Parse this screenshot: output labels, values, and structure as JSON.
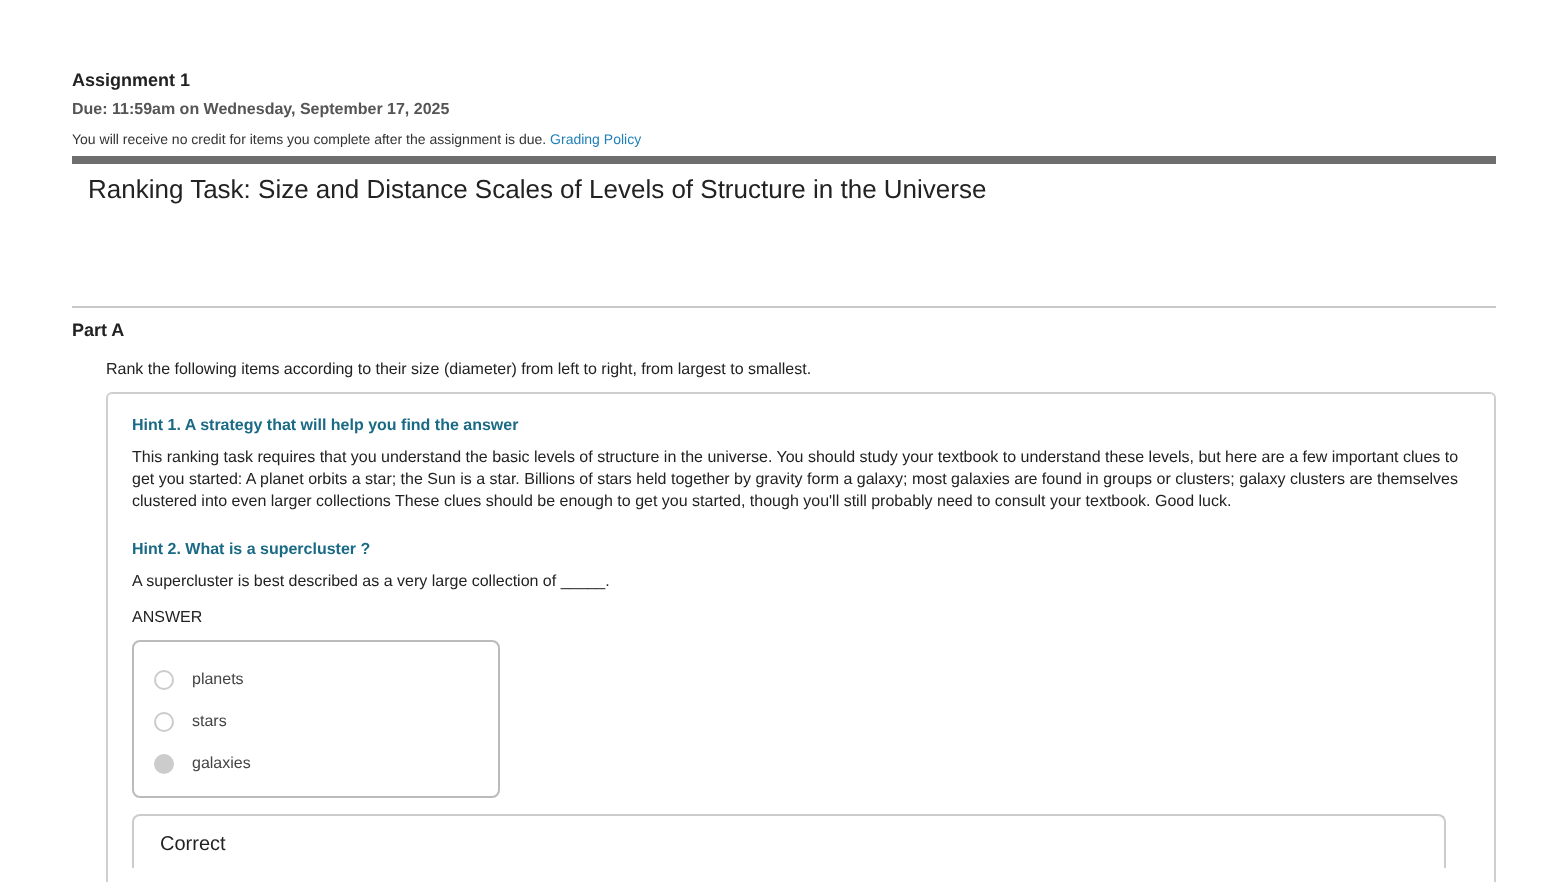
{
  "assignment": {
    "title": "Assignment 1",
    "due": "Due: 11:59am on Wednesday, September 17, 2025",
    "notice": "You will receive no credit for items you complete after the assignment is due.",
    "policy_link": "Grading Policy"
  },
  "task_title": "Ranking Task: Size and Distance Scales of Levels of Structure in the Universe",
  "part": {
    "label": "Part A",
    "instruction": "Rank the following items according to their size (diameter) from left to right, from largest to smallest.",
    "hints": [
      {
        "title": "Hint 1. A strategy that will help you find the answer",
        "text": "This ranking task requires that you understand the basic levels of structure in the universe. You should study your textbook to understand these levels, but here are a few important clues to get you started: A planet orbits a star; the Sun is a star. Billions of stars held together by gravity form a galaxy; most galaxies are found in groups or clusters; galaxy clusters are themselves clustered into even larger collections These clues should be enough to get you started, though you'll still probably need to consult your textbook. Good luck."
      },
      {
        "title": "Hint 2. What is a supercluster ?",
        "text": "A supercluster is best described as a very large collection of _____.",
        "answer_label": "ANSWER",
        "options": [
          {
            "label": "planets",
            "selected": false
          },
          {
            "label": "stars",
            "selected": false
          },
          {
            "label": "galaxies",
            "selected": true
          }
        ],
        "feedback": "Correct"
      }
    ]
  }
}
